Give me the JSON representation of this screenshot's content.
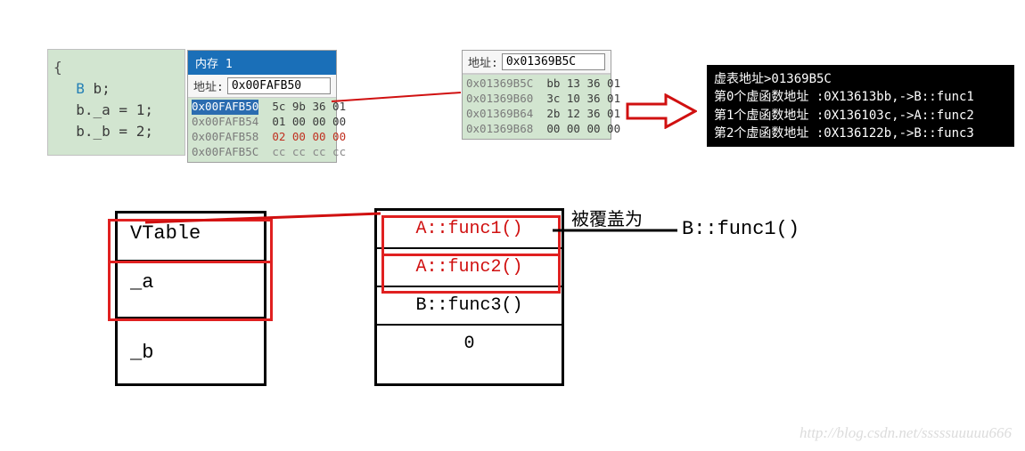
{
  "code": {
    "open_brace": "{",
    "line1_type": "B",
    "line1_rest": " b;",
    "line2": "b._a = 1;",
    "line3": "b._b = 2;"
  },
  "mem1": {
    "title": "内存 1",
    "addr_label": "地址:",
    "addr_value": "0x00FAFB50",
    "rows": [
      {
        "addr": "0x00FAFB50",
        "bytes": "5c 9b 36 01",
        "style": "norm",
        "sel": true
      },
      {
        "addr": "0x00FAFB54",
        "bytes": "01 00 00 00",
        "style": "norm"
      },
      {
        "addr": "0x00FAFB58",
        "bytes": "02 00 00 00",
        "style": "red"
      },
      {
        "addr": "0x00FAFB5C",
        "bytes": "cc cc cc cc",
        "style": "gray"
      }
    ]
  },
  "mem2": {
    "addr_label": "地址:",
    "addr_value": "0x01369B5C",
    "rows": [
      {
        "addr": "0x01369B5C",
        "bytes": "bb 13 36 01",
        "style": "norm"
      },
      {
        "addr": "0x01369B60",
        "bytes": "3c 10 36 01",
        "style": "norm"
      },
      {
        "addr": "0x01369B64",
        "bytes": "2b 12 36 01",
        "style": "norm"
      },
      {
        "addr": "0x01369B68",
        "bytes": "00 00 00 00",
        "style": "norm"
      }
    ]
  },
  "console_lines": [
    "虚表地址>01369B5C",
    "第0个虚函数地址 :0X13613bb,->B::func1",
    "第1个虚函数地址 :0X136103c,->A::func2",
    "第2个虚函数地址 :0X136122b,->B::func3"
  ],
  "obj": {
    "vtable": "VTable",
    "a": "_a",
    "b": "_b"
  },
  "vtable": {
    "r1": "A::func1()",
    "r2": "A::func2()",
    "r3": "B::func3()",
    "r4": "0"
  },
  "label_overwrite": "被覆盖为",
  "label_func": "B::func1()",
  "watermark": "http://blog.csdn.net/sssssuuuuu666"
}
